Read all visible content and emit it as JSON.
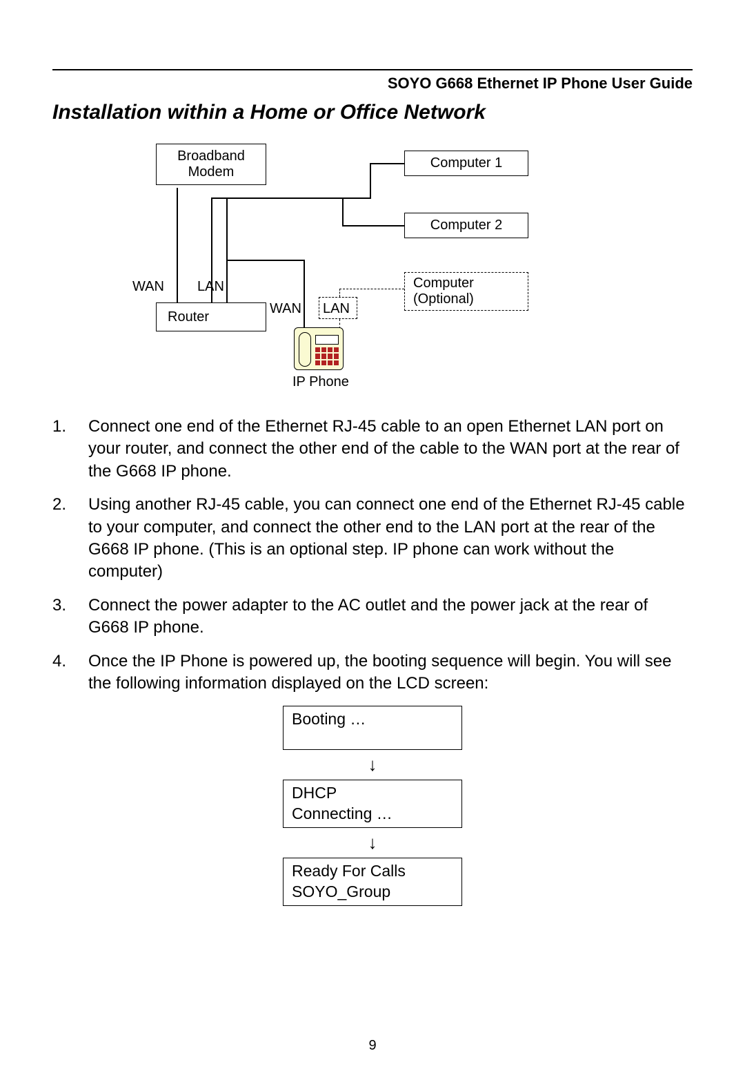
{
  "header": {
    "title": "SOYO G668 Ethernet IP Phone User Guide"
  },
  "section_title": "Installation within a Home or Office Network",
  "diagram": {
    "broadband_modem": "Broadband\nModem",
    "router": "Router",
    "computer1": "Computer 1",
    "computer2": "Computer 2",
    "computer_optional": "Computer\n(Optional)",
    "wan1": "WAN",
    "lan1": "LAN",
    "wan2": "WAN",
    "lan2": "LAN",
    "ip_phone": "IP Phone"
  },
  "steps": {
    "s1_num": "1.",
    "s1": "Connect one end of the Ethernet RJ-45 cable to an open Ethernet LAN port on your router, and connect the other end of the cable to the WAN port at the rear of the G668 IP phone.",
    "s2_num": "2.",
    "s2": "Using another RJ-45 cable, you can connect one end of the Ethernet RJ-45 cable to your computer, and connect the other end to the LAN port at the rear of the G668 IP phone. (This is an optional step. IP phone can work without the computer)",
    "s3_num": "3.",
    "s3": "Connect the power adapter to the AC outlet and the power jack at the rear of G668 IP phone.",
    "s4_num": "4.",
    "s4": "Once the IP Phone is powered up, the booting sequence will begin. You will see the following information displayed on the LCD screen:"
  },
  "lcd": {
    "booting": "Booting …",
    "dhcp_l1": "DHCP",
    "dhcp_l2": "Connecting …",
    "ready_l1": "Ready For Calls",
    "ready_l2": "SOYO_Group"
  },
  "page_number": "9"
}
